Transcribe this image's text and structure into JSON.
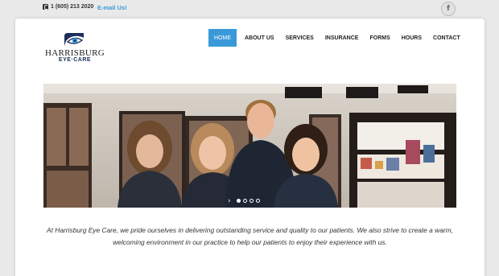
{
  "topbar": {
    "phone_icon": "phone-icon",
    "phone": "1 (605) 213 2020",
    "email_link": "E-mail Us!",
    "social_icon": "facebook-icon",
    "social_label": "f"
  },
  "logo": {
    "name": "HARRISBURG",
    "sub": "EYE·CARE"
  },
  "nav": {
    "items": [
      "HOME",
      "ABOUT US",
      "SERVICES",
      "INSURANCE",
      "FORMS",
      "HOURS",
      "CONTACT"
    ],
    "active_index": 0
  },
  "slider": {
    "arrow": "›",
    "slide_count": 4,
    "current_slide": 1
  },
  "intro_text": "At Harrisburg Eye Care, we pride ourselves in delivering outstanding service and quality to our patients.  We also strive to create a warm, welcoming environment in our practice to help our patients to enjoy their experience with us.",
  "colors": {
    "accent": "#3a9ad9",
    "brand_navy": "#1c2f5a"
  }
}
